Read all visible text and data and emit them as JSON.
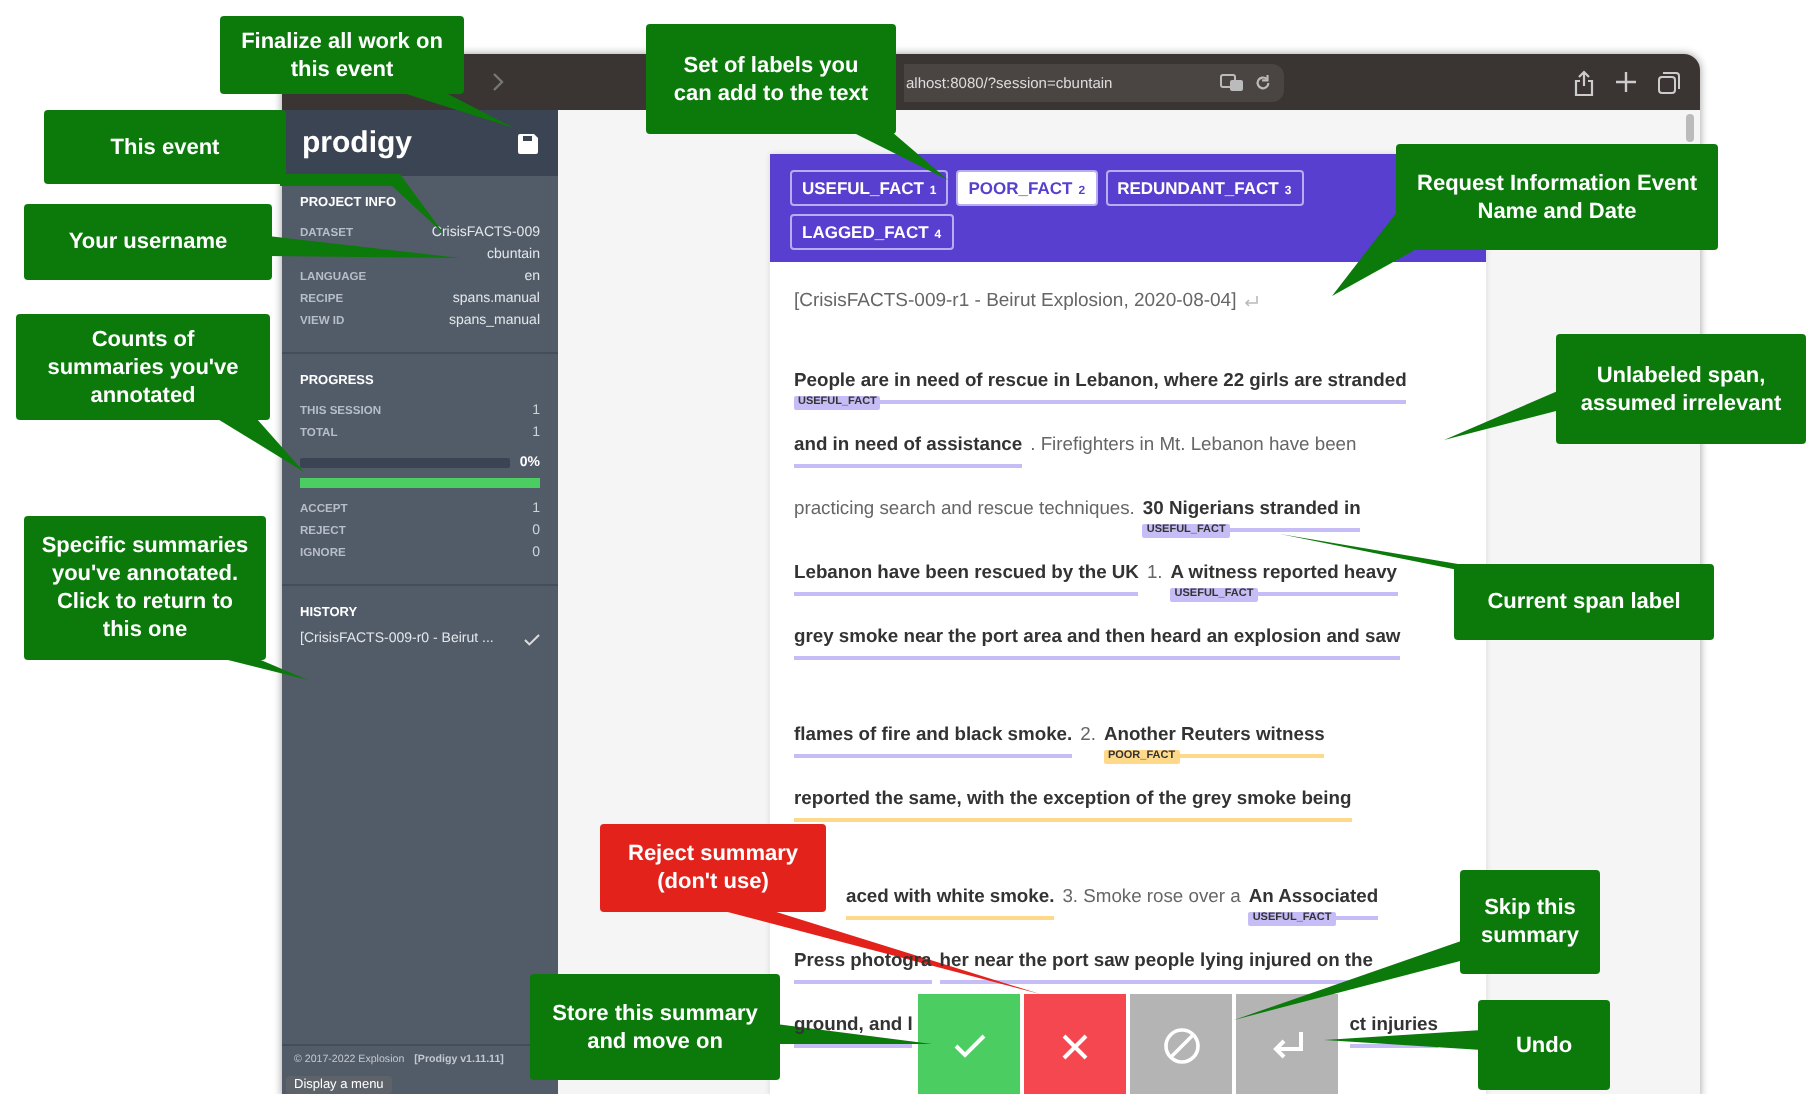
{
  "browser": {
    "address": "alhost:8080/?session=cbuntain"
  },
  "sidebar": {
    "logo": "prodigy",
    "project_info": {
      "title": "PROJECT INFO",
      "rows": [
        {
          "label": "DATASET",
          "value": "CrisisFACTS-009"
        },
        {
          "value": "cbuntain"
        },
        {
          "label": "LANGUAGE",
          "value": "en"
        },
        {
          "label": "RECIPE",
          "value": "spans.manual"
        },
        {
          "label": "VIEW ID",
          "value": "spans_manual"
        }
      ]
    },
    "progress": {
      "title": "PROGRESS",
      "rows": [
        {
          "label": "THIS SESSION",
          "value": "1"
        },
        {
          "label": "TOTAL",
          "value": "1"
        }
      ],
      "level": 0,
      "percent": "0%",
      "accept_bar": {
        "level": 1
      },
      "counts": [
        {
          "label": "ACCEPT",
          "value": "1"
        },
        {
          "label": "REJECT",
          "value": "0"
        },
        {
          "label": "IGNORE",
          "value": "0"
        }
      ]
    },
    "history": {
      "title": "HISTORY",
      "items": [
        {
          "text": "[CrisisFACTS-009-r0 - Beirut ...",
          "accepted": true
        }
      ]
    },
    "footer": {
      "copyright": "© 2017-2022 Explosion",
      "version": "[Prodigy v1.11.11]"
    },
    "tooltip": "Display a menu"
  },
  "labels": [
    {
      "text": "USEFUL_FACT",
      "key": "1",
      "selected": false
    },
    {
      "text": "POOR_FACT",
      "key": "2",
      "selected": true
    },
    {
      "text": "REDUNDANT_FACT",
      "key": "3",
      "selected": false
    },
    {
      "text": "LAGGED_FACT",
      "key": "4",
      "selected": false
    }
  ],
  "document": {
    "title": "[CrisisFACTS-009-r1 - Beirut Explosion, 2020-08-04]",
    "lines": [
      {
        "segments": [
          {
            "text": "People are in need of rescue in Lebanon, where 22 girls are stranded",
            "color": "#c6bdf6",
            "tag": "USEFUL_FACT"
          }
        ]
      },
      {
        "segments": [
          {
            "text": "and in need of assistance",
            "color": "#c6bdf6"
          },
          {
            "text": ". Firefighters in Mt. Lebanon have been"
          }
        ]
      },
      {
        "segments": [
          {
            "text": "practicing search and rescue techniques."
          },
          {
            "text": "30 Nigerians stranded in",
            "color": "#c6bdf6",
            "tag": "USEFUL_FACT"
          }
        ]
      },
      {
        "segments": [
          {
            "text": "Lebanon have been rescued by the UK",
            "color": "#c6bdf6"
          },
          {
            "text": "1."
          },
          {
            "text": "A witness reported heavy",
            "color": "#c6bdf6",
            "tag": "USEFUL_FACT"
          }
        ]
      },
      {
        "segments": [
          {
            "text": "grey smoke near the port area and then heard an explosion and saw",
            "color": "#c6bdf6"
          }
        ]
      },
      {
        "new_paragraph": true,
        "segments": [
          {
            "text": "flames of fire and black smoke.",
            "color": "#c6bdf6"
          },
          {
            "text": "2."
          },
          {
            "text": "Another Reuters witness",
            "color": "#ffd98a",
            "tag": "POOR_FACT"
          }
        ]
      },
      {
        "segments": [
          {
            "text": "reported the same, with the exception of the grey smoke being",
            "color": "#ffd98a"
          }
        ]
      },
      {
        "new_paragraph": true,
        "segments": [
          {
            "text": "aced with white smoke.",
            "color": "#ffd98a",
            "hidden_start": true
          },
          {
            "text": "3. Smoke rose over a"
          },
          {
            "text": "An Associated",
            "color": "#c6bdf6",
            "tag": "USEFUL_FACT"
          }
        ]
      },
      {
        "segments": [
          {
            "text": "Press photogra",
            "color": "#c6bdf6"
          },
          {
            "text": "her near the port saw people lying injured on the",
            "color": "#c6bdf6"
          }
        ]
      },
      {
        "split": true,
        "segments": [
          {
            "text": "ground, and l",
            "color": "#c6bdf6"
          },
          {
            "text": "ct injuries",
            "color": "#c6bdf6"
          }
        ]
      }
    ]
  },
  "actions": [
    {
      "kind": "accept"
    },
    {
      "kind": "reject"
    },
    {
      "kind": "ignore"
    },
    {
      "kind": "undo"
    }
  ],
  "callouts": [
    {
      "text": "Finalize all work on this event",
      "kind": "info"
    },
    {
      "text": "This event",
      "kind": "info"
    },
    {
      "text": "Your username",
      "kind": "info"
    },
    {
      "text": "Counts of summaries you've annotated",
      "kind": "info"
    },
    {
      "text": "Specific summaries you've annotated. Click to return to this one",
      "kind": "info"
    },
    {
      "text": "Set of labels you can add to the text",
      "kind": "info"
    },
    {
      "text": "Request Information Event Name and Date",
      "kind": "info"
    },
    {
      "text": "Unlabeled span, assumed irrelevant",
      "kind": "info"
    },
    {
      "text": "Current span label",
      "kind": "info"
    },
    {
      "text": "Reject summary (don't use)",
      "kind": "warning"
    },
    {
      "text": "Skip this summary",
      "kind": "info"
    },
    {
      "text": "Store this summary and move on",
      "kind": "info"
    },
    {
      "text": "Undo",
      "kind": "info"
    }
  ]
}
